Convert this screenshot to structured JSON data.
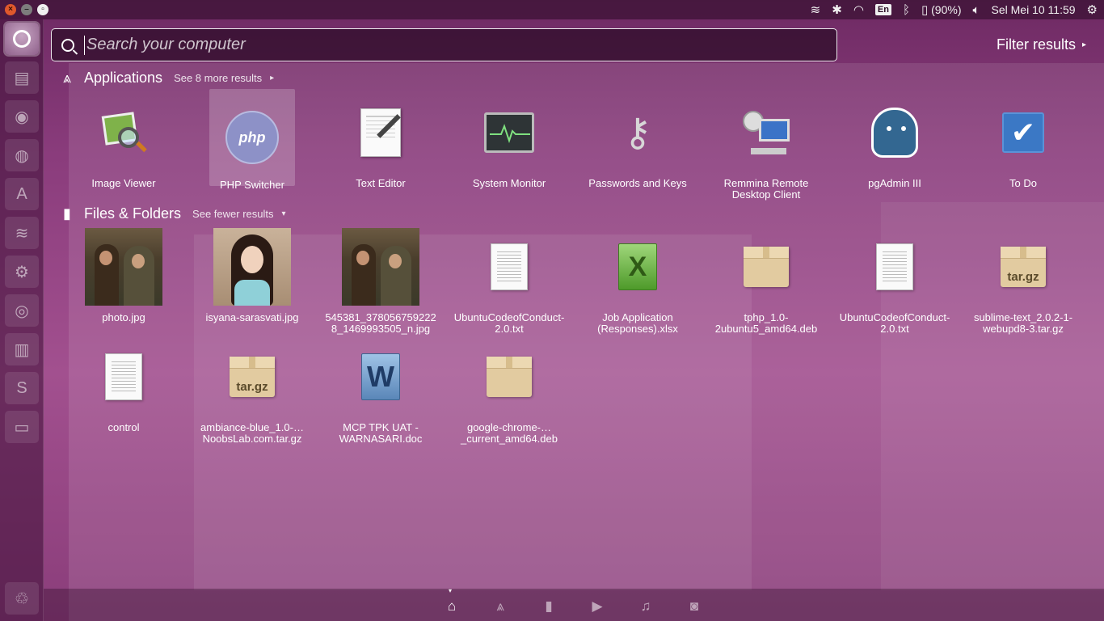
{
  "window_controls": {
    "close": "×",
    "minimize": "–",
    "maximize": "▫"
  },
  "top_panel": {
    "keyboard_layout": "En",
    "battery_text": "(90%)",
    "clock": "Sel Mei 10 11:59"
  },
  "search": {
    "placeholder": "Search your computer",
    "value": ""
  },
  "filter": {
    "label": "Filter results"
  },
  "applications": {
    "title": "Applications",
    "more_link": "See 8 more results",
    "items": [
      {
        "label": "Image Viewer"
      },
      {
        "label": "PHP Switcher"
      },
      {
        "label": "Text Editor"
      },
      {
        "label": "System Monitor"
      },
      {
        "label": "Passwords and Keys"
      },
      {
        "label": "Remmina Remote Desktop Client"
      },
      {
        "label": "pgAdmin III"
      },
      {
        "label": "To Do"
      }
    ]
  },
  "files": {
    "title": "Files & Folders",
    "more_link": "See fewer results",
    "items": [
      {
        "label": "photo.jpg"
      },
      {
        "label": "isyana-sarasvati.jpg"
      },
      {
        "label": "545381_3780567592228_1469993505_n.jpg"
      },
      {
        "label": "UbuntuCodeofConduct-2.0.txt"
      },
      {
        "label": "Job Application (Responses).xlsx"
      },
      {
        "label": "tphp_1.0-2ubuntu5_amd64.deb"
      },
      {
        "label": "UbuntuCodeofConduct-2.0.txt"
      },
      {
        "label": "sublime-text_2.0.2-1-webupd8-3.tar.gz"
      },
      {
        "label": "control"
      },
      {
        "label": "ambiance-blue_1.0-…NoobsLab.com.tar.gz"
      },
      {
        "label": "MCP TPK UAT - WARNASARI.doc"
      },
      {
        "label": "google-chrome-…_current_amd64.deb"
      }
    ],
    "archive_badge": "tar.gz",
    "xls_glyph": "X",
    "doc_glyph": "W"
  },
  "icon_glyphs": {
    "php": "php"
  }
}
